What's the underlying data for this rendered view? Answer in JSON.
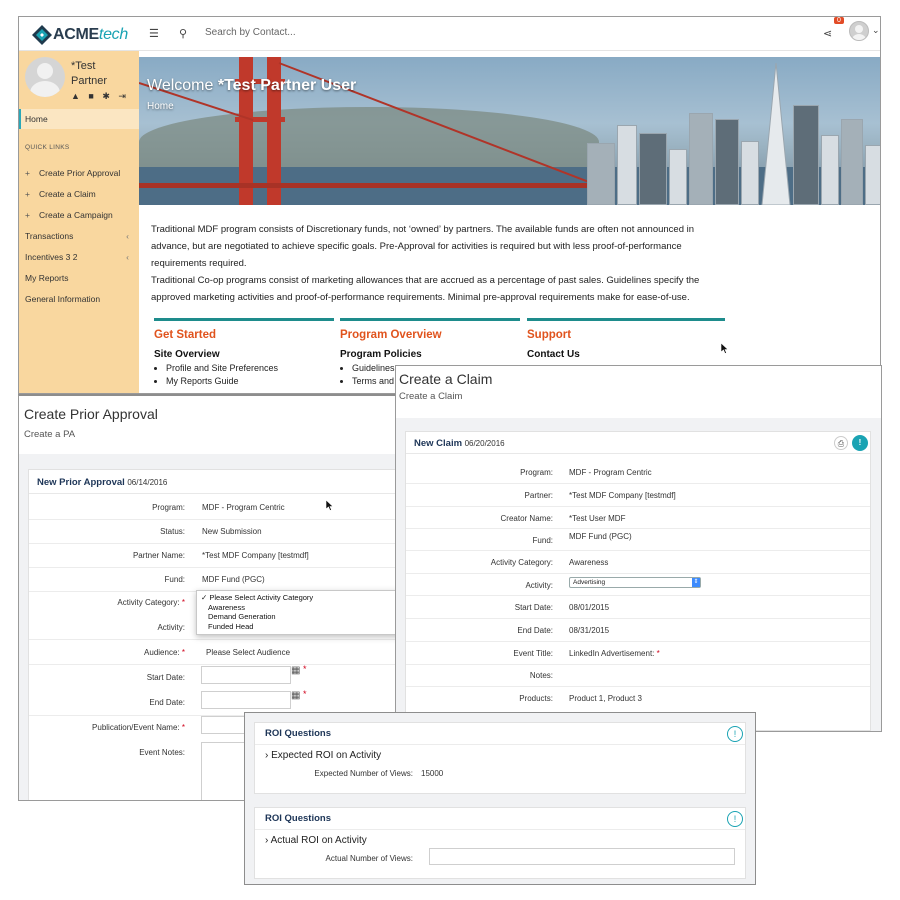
{
  "portal": {
    "logo_acme": "ACME",
    "logo_tech": "tech",
    "menu_icon": "☰",
    "search_icon": "⚲",
    "search_placeholder": "Search by Contact...",
    "share_icon": "⋖",
    "notification_count": "0",
    "avatar_caret": "⌄",
    "user_name": "*Test Partner",
    "user_icons": "▲ ■ ✱ ⇥",
    "hero_welcome_prefix": "Welcome ",
    "hero_welcome_name": "*Test Partner User",
    "hero_breadcrumb": "Home",
    "sidebar": {
      "home": "Home",
      "quick_links_heading": "QUICK LINKS",
      "quick_links": [
        "Create Prior Approval",
        "Create a Claim",
        "Create a Campaign"
      ],
      "items": [
        "Transactions",
        "Incentives 3 2",
        "My Reports",
        "General Information"
      ],
      "plus": "+",
      "chevron": "‹"
    },
    "description": [
      "Traditional MDF program consists of Discretionary funds, not ‘owned’ by partners. The available funds are often not announced in advance, but are negotiated to achieve specific goals. Pre-Approval for activities is required but with less proof-of-performance requirements required.",
      "Traditional Co-op programs consist of marketing allowances that are accrued as a percentage of past sales. Guidelines specify the approved marketing activities and proof-of-performance requirements. Minimal pre-approval requirements make for ease-of-use."
    ],
    "columns": [
      {
        "title": "Get Started",
        "subtitle": "Site Overview",
        "links": [
          "Profile and Site Preferences",
          "My Reports Guide"
        ]
      },
      {
        "title": "Program Overview",
        "subtitle": "Program Policies",
        "links": [
          "Guidelines",
          "Terms and"
        ]
      },
      {
        "title": "Support",
        "subtitle": "Contact Us",
        "links": []
      }
    ],
    "colors": {
      "accent": "#1aa3b3",
      "sidebar": "#f9d79f",
      "heading_orange": "#e0531d",
      "divider_teal": "#1e8c8c"
    }
  },
  "prior_approval": {
    "title": "Create Prior Approval",
    "subtitle": "Create a PA",
    "card_title": "New Prior Approval",
    "card_date": "06/14/2016",
    "fields": {
      "program_label": "Program:",
      "program_value": "MDF - Program Centric",
      "status_label": "Status:",
      "status_value": "New Submission",
      "partner_label": "Partner Name:",
      "partner_value": "*Test MDF Company [testmdf]",
      "fund_label": "Fund:",
      "fund_value": "MDF Fund (PGC)",
      "activity_category_label": "Activity Category:",
      "activity_label": "Activity:",
      "audience_label": "Audience:",
      "audience_value": "Please Select Audience",
      "start_date_label": "Start Date:",
      "end_date_label": "End Date:",
      "publication_label": "Publication/Event Name:",
      "event_notes_label": "Event Notes:"
    },
    "required_mark": "*",
    "calendar_icon": "▦",
    "dropdown_options": {
      "selected": "✓ Please Select Activity Category",
      "options": [
        "Awareness",
        "Demand Generation",
        "Funded Head"
      ]
    }
  },
  "claim": {
    "title": "Create a Claim",
    "subtitle": "Create a Claim",
    "card_title": "New Claim",
    "card_date": "06/20/2016",
    "print_icon": "⎙",
    "info_icon": "!",
    "fields": {
      "program_label": "Program:",
      "program_value": "MDF - Program Centric",
      "partner_label": "Partner:",
      "partner_value": "*Test MDF Company [testmdf]",
      "creator_label": "Creator Name:",
      "creator_value": "*Test User MDF",
      "fund_label": "Fund:",
      "fund_value": "MDF Fund (PGC)",
      "activity_category_label": "Activity Category:",
      "activity_category_value": "Awareness",
      "activity_label": "Activity:",
      "activity_value": "Advertising",
      "start_date_label": "Start Date:",
      "start_date_value": "08/01/2015",
      "end_date_label": "End Date:",
      "end_date_value": "08/31/2015",
      "event_title_label": "Event Title:",
      "event_title_value": "LinkedIn Advertisement:",
      "notes_label": "Notes:",
      "products_label": "Products:",
      "products_value": "Product 1, Product 3"
    },
    "select_arrow": "⇕"
  },
  "roi": {
    "cards": [
      {
        "title": "ROI Questions",
        "section": "Expected ROI on Activity",
        "field_label": "Expected Number of Views:",
        "field_value": "15000"
      },
      {
        "title": "ROI Questions",
        "section": "Actual ROI on Activity",
        "field_label": "Actual Number of Views:",
        "field_value": ""
      }
    ],
    "info_icon": "!",
    "chevron": "›"
  }
}
